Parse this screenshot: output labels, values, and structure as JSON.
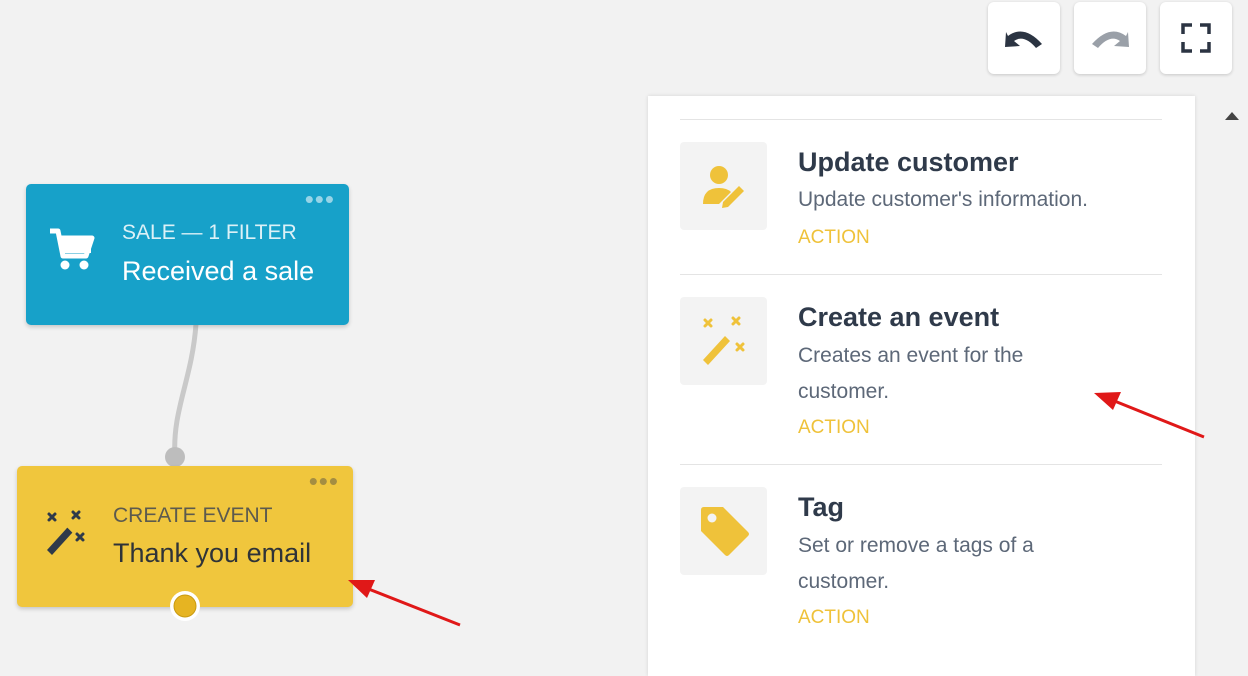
{
  "toolbar": {
    "undo_icon": "undo-icon",
    "redo_icon": "redo-icon",
    "fullscreen_icon": "fullscreen-icon"
  },
  "canvas": {
    "trigger_node": {
      "type_label": "SALE — 1 FILTER",
      "title": "Received a sale",
      "icon": "shopping-cart-icon",
      "color": "#17a1c9"
    },
    "action_node": {
      "type_label": "CREATE EVENT",
      "title": "Thank you email",
      "icon": "magic-wand-icon",
      "color": "#f0c63d"
    }
  },
  "panel": {
    "items": [
      {
        "title": "Update customer",
        "description": "Update customer's information.",
        "tag": "ACTION",
        "icon": "user-edit-icon"
      },
      {
        "title": "Create an event",
        "description": "Creates an event for the customer.",
        "tag": "ACTION",
        "icon": "magic-wand-icon"
      },
      {
        "title": "Tag",
        "description": "Set or remove a tags of a customer.",
        "tag": "ACTION",
        "icon": "tag-icon"
      }
    ],
    "accent_color": "#efc23a"
  }
}
